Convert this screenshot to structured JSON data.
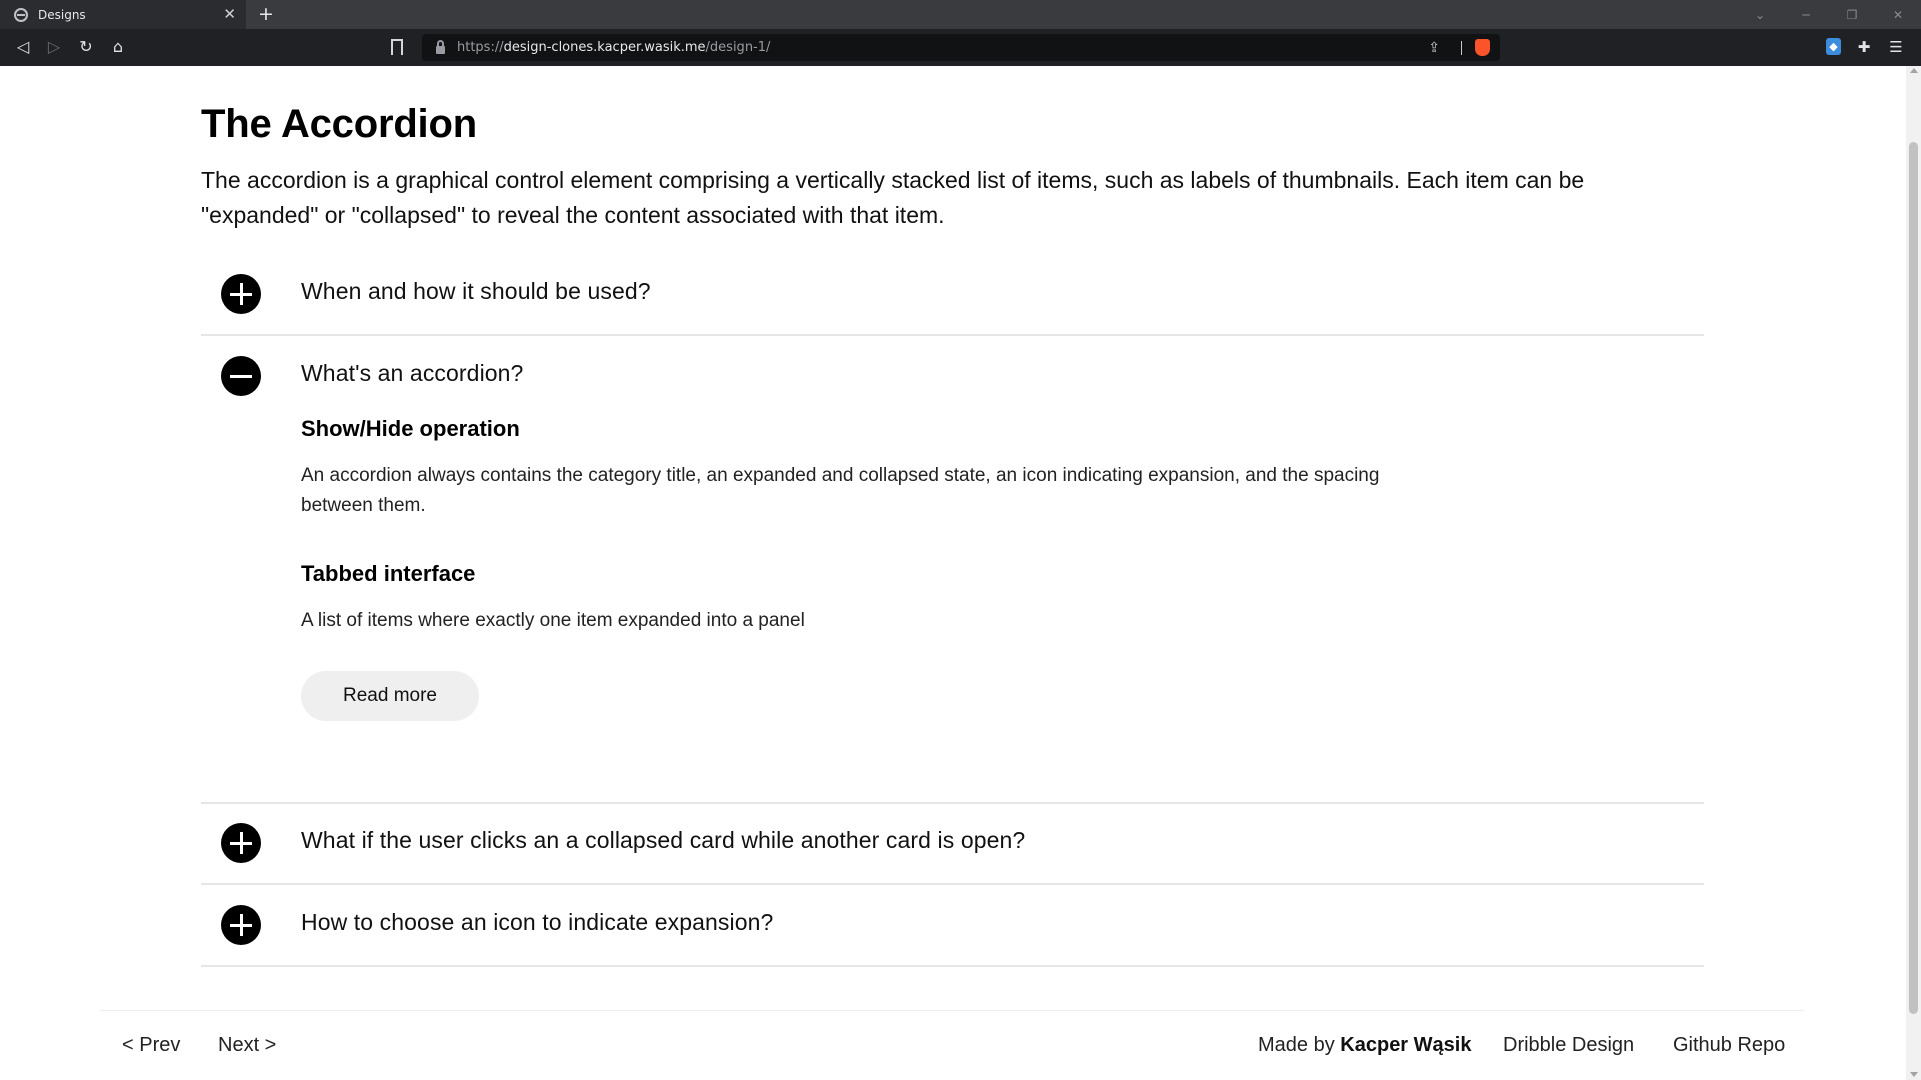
{
  "browser": {
    "tab_title": "Designs",
    "tab_close": "✕",
    "new_tab": "+",
    "url_scheme": "https://",
    "url_host": "design-clones.kacper.wasik.me",
    "url_path": "/design-1/"
  },
  "page": {
    "title": "The Accordion",
    "intro": "The accordion is a graphical control element comprising a vertically stacked list of items, such as labels of thumbnails. Each item can be \"expanded\" or \"collapsed\" to reveal the content associated with that item."
  },
  "accordion": {
    "items": [
      {
        "question": "When and how it should be used?",
        "expanded": false
      },
      {
        "question": "What's an accordion?",
        "expanded": true
      },
      {
        "question": "What if the user clicks an a collapsed card while another card is open?",
        "expanded": false
      },
      {
        "question": "How to choose an icon to indicate expansion?",
        "expanded": false
      }
    ],
    "expanded_content": {
      "section1_title": "Show/Hide operation",
      "section1_text": "An accordion always contains the category title, an expanded and collapsed state, an icon indicating expansion, and the spacing between them.",
      "section2_title": "Tabbed interface",
      "section2_text": "A list of items where exactly one item expanded into a panel",
      "read_more_label": "Read more"
    }
  },
  "footer": {
    "prev": "< Prev",
    "next": "Next >",
    "made_by_prefix": "Made by",
    "author": "Kacper Wąsik",
    "dribble": "Dribble Design",
    "github": "Github Repo"
  }
}
